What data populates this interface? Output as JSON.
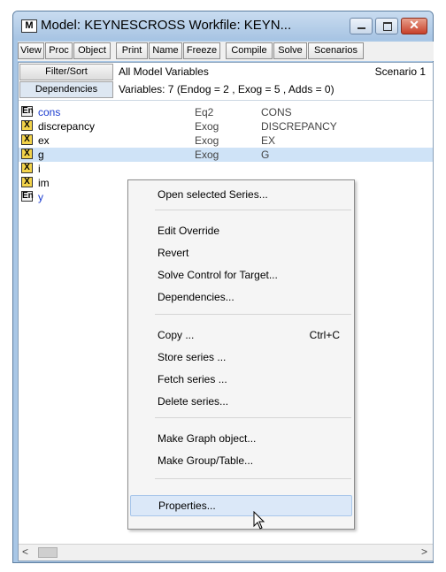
{
  "window": {
    "icon_label": "M",
    "title": "Model: KEYNESCROSS   Workfile: KEYN..."
  },
  "toolbar": [
    "View",
    "Proc",
    "Object",
    "Print",
    "Name",
    "Freeze",
    "Compile",
    "Solve",
    "Scenarios"
  ],
  "panel": {
    "filter_label": "Filter/Sort",
    "dependencies_label": "Dependencies",
    "header_title": "All Model Variables",
    "scenario": "Scenario 1",
    "summary": "Variables: 7  (Endog = 2 , Exog = 5 , Adds = 0)"
  },
  "variables": [
    {
      "badge": "En",
      "name": "cons",
      "type": "Eq2",
      "expr": "CONS"
    },
    {
      "badge": "X",
      "name": "discrepancy",
      "type": "Exog",
      "expr": "DISCREPANCY"
    },
    {
      "badge": "X",
      "name": "ex",
      "type": "Exog",
      "expr": "EX"
    },
    {
      "badge": "X",
      "name": "g",
      "type": "Exog",
      "expr": "G"
    },
    {
      "badge": "X",
      "name": "i",
      "type": "",
      "expr": ""
    },
    {
      "badge": "X",
      "name": "im",
      "type": "",
      "expr": ""
    },
    {
      "badge": "En",
      "name": "y",
      "type": "",
      "expr": ""
    }
  ],
  "context_menu": {
    "open": "Open selected Series...",
    "edit_override": "Edit Override",
    "revert": "Revert",
    "solve_control": "Solve Control for Target...",
    "dependencies": "Dependencies...",
    "copy": "Copy ...",
    "copy_shortcut": "Ctrl+C",
    "store": "Store series ...",
    "fetch": "Fetch series ...",
    "delete": "Delete series...",
    "make_graph": "Make Graph object...",
    "make_group": "Make Group/Table...",
    "properties": "Properties..."
  },
  "scrollbar": {
    "left_arrow": "<",
    "right_arrow": ">"
  }
}
